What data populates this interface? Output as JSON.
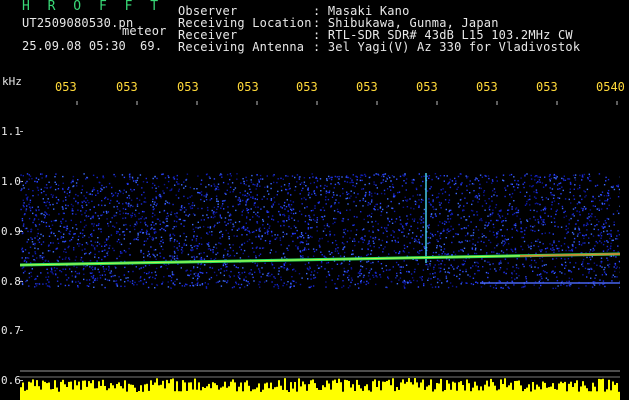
{
  "header": {
    "brand": "H R O F F T",
    "filename": "UT2509080530.pn",
    "meteor_label": "meteor",
    "timestamp": "25.09.08 05:30",
    "meteor_count": "69.",
    "info": [
      {
        "label": "Observer",
        "value": ": Masaki Kano"
      },
      {
        "label": "Receiving Location",
        "value": ": Shibukawa, Gunma, Japan"
      },
      {
        "label": "Receiver",
        "value": ": RTL-SDR SDR# 43dB L15 103.2MHz CW"
      },
      {
        "label": "Receiving Antenna",
        "value": ": 3el Yagi(V) Az 330 for Vladivostok"
      }
    ]
  },
  "y_axis": {
    "unit": "kHz",
    "labels": [
      "1.1",
      "1.0",
      "0.9",
      "0.8",
      "0.7",
      "0.6"
    ]
  },
  "time_axis": {
    "labels": [
      "053",
      "053",
      "053",
      "053",
      "053",
      "053",
      "053",
      "053",
      "053",
      "0540"
    ]
  },
  "colors": {
    "time_labels": "#ffd93a",
    "brand": "#39d977",
    "noise_blue": "#1a2ad8",
    "carrier_green": "#2fe05a",
    "carrier_red": "#ff3a1a",
    "baseline_yellow": "#ffff00"
  }
}
